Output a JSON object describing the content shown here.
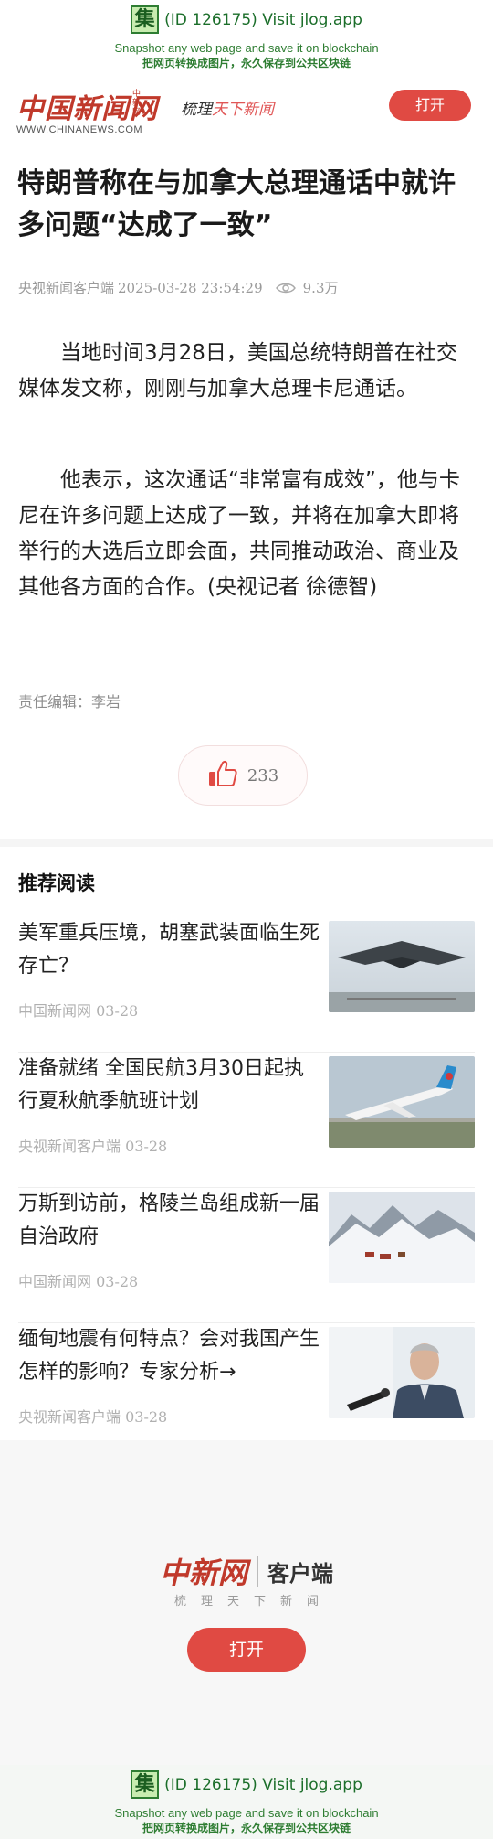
{
  "jlog": {
    "icon_char": "集",
    "id_text": "(ID 126175) Visit jlog.app",
    "line_en": "Snapshot any web page and save it on blockchain",
    "line_cn": "把网页转换成图片，永久保存到公共区块链"
  },
  "header": {
    "logo_cn": "中国新闻网",
    "logo_sub": "中新网",
    "logo_en": "WWW.CHINANEWS.COM",
    "slogan_a": "梳理",
    "slogan_b": "天下新闻",
    "open_label": "打开",
    "colors": {
      "brand": "#c0392b",
      "button": "#e04a43"
    }
  },
  "article": {
    "title": "特朗普称在与加拿大总理通话中就许多问题“达成了一致”",
    "source": "央视新闻客户端",
    "datetime": "2025-03-28 23:54:29",
    "views": "9.3万",
    "paragraphs": [
      "当地时间3月28日，美国总统特朗普在社交媒体发文称，刚刚与加拿大总理卡尼通话。",
      "他表示，这次通话“非常富有成效”，他与卡尼在许多问题上达成了一致，并将在加拿大即将举行的大选后立即会面，共同推动政治、商业及其他各方面的合作。(央视记者 徐德智)"
    ],
    "editor": "责任编辑：李岩",
    "likes": "233"
  },
  "recommend": {
    "heading": "推荐阅读",
    "items": [
      {
        "title": "美军重兵压境，胡塞武装面临生死存亡？",
        "source": "中国新闻网",
        "date": "03-28",
        "thumb": "stealth-bomber-image"
      },
      {
        "title": "准备就绪 全国民航3月30日起执行夏秋航季航班计划",
        "source": "央视新闻客户端",
        "date": "03-28",
        "thumb": "airplane-image"
      },
      {
        "title": "万斯到访前，格陵兰岛组成新一届自治政府",
        "source": "中国新闻网",
        "date": "03-28",
        "thumb": "greenland-image"
      },
      {
        "title": "缅甸地震有何特点？会对我国产生怎样的影响？专家分析→",
        "source": "央视新闻客户端",
        "date": "03-28",
        "thumb": "expert-interview-image"
      }
    ]
  },
  "promo": {
    "logo_cn": "中新网",
    "logo_text": "客户端",
    "tagline": "梳理天下新闻",
    "open_label": "打开"
  }
}
